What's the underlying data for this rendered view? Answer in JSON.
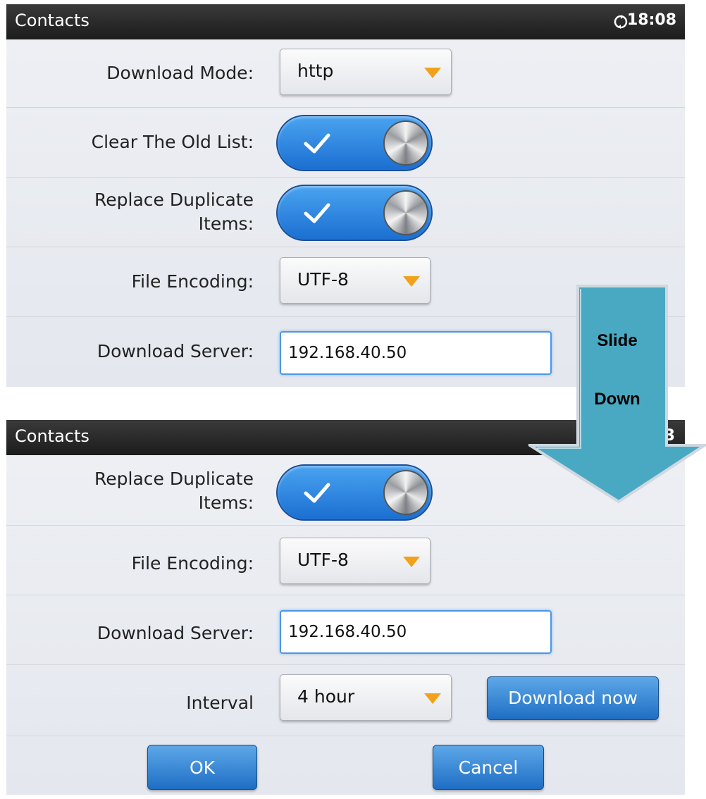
{
  "screen_top": {
    "statusbar": {
      "title": "Contacts",
      "time": "18:08",
      "sync_icon": "sync-icon"
    },
    "download_mode": {
      "label": "Download Mode:",
      "value": "http"
    },
    "clear_old_list": {
      "label": "Clear The Old List:",
      "enabled": true
    },
    "replace_duplicate": {
      "label_line1": "Replace Duplicate",
      "label_line2": "Items:",
      "enabled": true
    },
    "file_encoding": {
      "label": "File Encoding:",
      "value": "UTF-8"
    },
    "download_server": {
      "label": "Download Server:",
      "value": "192.168.40.50"
    }
  },
  "overlay": {
    "line1": "Slide",
    "line2": "Down",
    "arrow_color": "#4aa9c2"
  },
  "screen_bottom": {
    "statusbar": {
      "title": "Contacts",
      "time_fragment": "3"
    },
    "replace_duplicate": {
      "label_line1": "Replace Duplicate",
      "label_line2": "Items:",
      "enabled": true
    },
    "file_encoding": {
      "label": "File Encoding:",
      "value": "UTF-8"
    },
    "download_server": {
      "label": "Download Server:",
      "value": "192.168.40.50"
    },
    "interval": {
      "label": "Interval",
      "value": "4 hour"
    },
    "download_now_label": "Download now",
    "ok_label": "OK",
    "cancel_label": "Cancel"
  },
  "colors": {
    "accent_blue": "#1e6ec4",
    "toggle_blue": "#2f8be4",
    "caret_orange": "#f1a21a",
    "statusbar": "#232323"
  }
}
